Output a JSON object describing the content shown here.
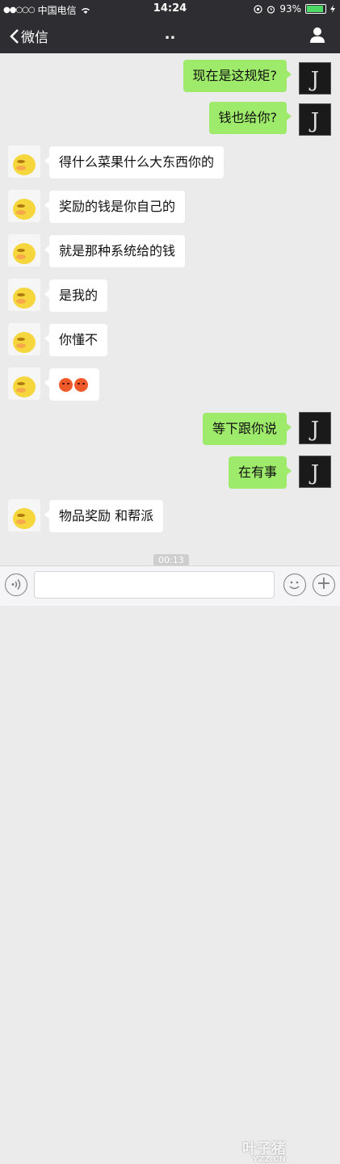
{
  "status_bar": {
    "signal": "●●○○○",
    "carrier": "中国电信",
    "time": "14:24",
    "battery": "93%"
  },
  "nav": {
    "back_label": "微信",
    "title": ".."
  },
  "messages": [
    {
      "side": "right",
      "text": "现在是这规矩?"
    },
    {
      "side": "right",
      "text": "钱也给你?"
    },
    {
      "side": "left",
      "text": "得什么菜果什么大东西你的"
    },
    {
      "side": "left",
      "text": "奖励的钱是你自己的"
    },
    {
      "side": "left",
      "text": "就是那种系统给的钱"
    },
    {
      "side": "left",
      "text": "是我的"
    },
    {
      "side": "left",
      "text": "你懂不"
    },
    {
      "side": "left",
      "text": "",
      "emoji": "angry-face-emoji"
    },
    {
      "side": "right",
      "text": "等下跟你说"
    },
    {
      "side": "right",
      "text": "在有事"
    },
    {
      "side": "left",
      "text": "物品奖励 和帮派"
    }
  ],
  "timestamp": "00:13",
  "watermark": {
    "text": "叶子猪",
    "sub": "YZZ.CN"
  },
  "colors": {
    "bar": "#2e2e32",
    "bubble_right": "#9eea6a",
    "bubble_left": "#ffffff",
    "background": "#ebebeb"
  }
}
